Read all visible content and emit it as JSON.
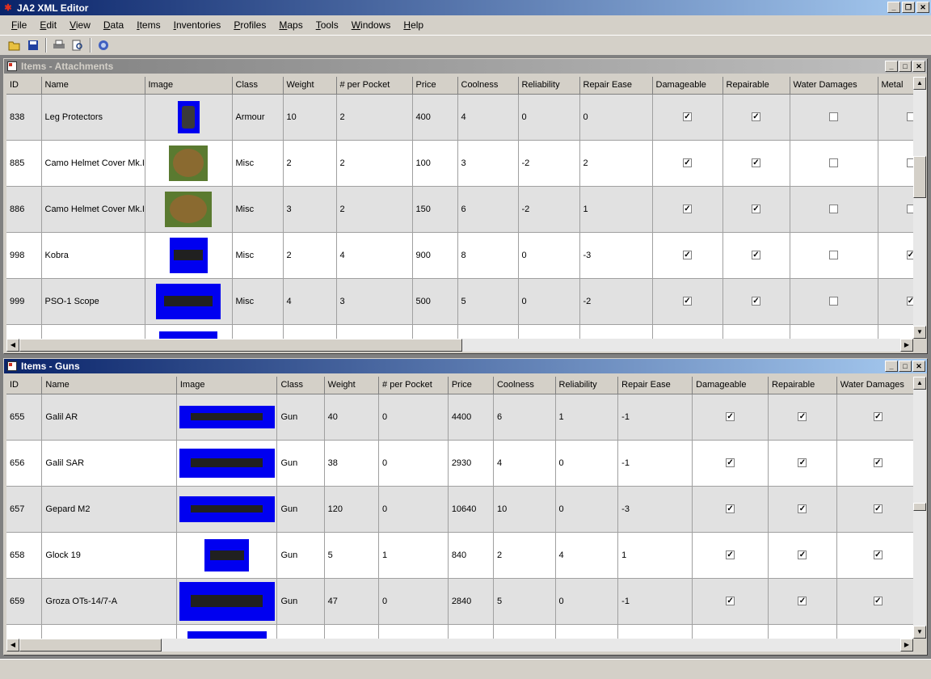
{
  "app": {
    "title": "JA2 XML Editor"
  },
  "menu": [
    {
      "u": "F",
      "rest": "ile"
    },
    {
      "u": "E",
      "rest": "dit"
    },
    {
      "u": "V",
      "rest": "iew"
    },
    {
      "u": "D",
      "rest": "ata"
    },
    {
      "u": "I",
      "rest": "tems"
    },
    {
      "u": "I",
      "rest": "nventories"
    },
    {
      "u": "P",
      "rest": "rofiles"
    },
    {
      "u": "M",
      "rest": "aps"
    },
    {
      "u": "T",
      "rest": "ools"
    },
    {
      "u": "W",
      "rest": "indows"
    },
    {
      "u": "H",
      "rest": "elp"
    }
  ],
  "toolbar": [
    "open-icon",
    "save-icon",
    "print-icon",
    "print-preview-icon",
    "help-icon"
  ],
  "attachments": {
    "title": "Items - Attachments",
    "columns": [
      "ID",
      "Name",
      "Image",
      "Class",
      "Weight",
      "# per Pocket",
      "Price",
      "Coolness",
      "Reliability",
      "Repair Ease",
      "Damageable",
      "Repairable",
      "Water Damages",
      "Metal"
    ],
    "rows": [
      {
        "id": "838",
        "name": "Leg Protectors",
        "img": "dark",
        "class": "Armour",
        "weight": "10",
        "pocket": "2",
        "price": "400",
        "cool": "4",
        "rel": "0",
        "rep": "0",
        "dmg": true,
        "repair": true,
        "water": false,
        "metal": false
      },
      {
        "id": "885",
        "name": "Camo Helmet Cover Mk.I",
        "img": "camo",
        "class": "Misc",
        "weight": "2",
        "pocket": "2",
        "price": "100",
        "cool": "3",
        "rel": "-2",
        "rep": "2",
        "dmg": true,
        "repair": true,
        "water": false,
        "metal": false
      },
      {
        "id": "886",
        "name": "Camo Helmet Cover Mk.II",
        "img": "camo",
        "class": "Misc",
        "weight": "3",
        "pocket": "2",
        "price": "150",
        "cool": "6",
        "rel": "-2",
        "rep": "1",
        "dmg": true,
        "repair": true,
        "water": false,
        "metal": false
      },
      {
        "id": "998",
        "name": "Kobra",
        "img": "blue",
        "class": "Misc",
        "weight": "2",
        "pocket": "4",
        "price": "900",
        "cool": "8",
        "rel": "0",
        "rep": "-3",
        "dmg": true,
        "repair": true,
        "water": false,
        "metal": true
      },
      {
        "id": "999",
        "name": "PSO-1 Scope",
        "img": "blue",
        "class": "Misc",
        "weight": "4",
        "pocket": "3",
        "price": "500",
        "cool": "5",
        "rel": "0",
        "rep": "-2",
        "dmg": true,
        "repair": true,
        "water": false,
        "metal": true
      }
    ]
  },
  "guns": {
    "title": "Items - Guns",
    "columns": [
      "ID",
      "Name",
      "Image",
      "Class",
      "Weight",
      "# per Pocket",
      "Price",
      "Coolness",
      "Reliability",
      "Repair Ease",
      "Damageable",
      "Repairable",
      "Water Damages"
    ],
    "rows": [
      {
        "id": "655",
        "name": "Galil AR",
        "img": "blue",
        "class": "Gun",
        "weight": "40",
        "pocket": "0",
        "price": "4400",
        "cool": "6",
        "rel": "1",
        "rep": "-1",
        "dmg": true,
        "repair": true,
        "water": true
      },
      {
        "id": "656",
        "name": "Galil SAR",
        "img": "blue",
        "class": "Gun",
        "weight": "38",
        "pocket": "0",
        "price": "2930",
        "cool": "4",
        "rel": "0",
        "rep": "-1",
        "dmg": true,
        "repair": true,
        "water": true
      },
      {
        "id": "657",
        "name": "Gepard M2",
        "img": "blue",
        "class": "Gun",
        "weight": "120",
        "pocket": "0",
        "price": "10640",
        "cool": "10",
        "rel": "0",
        "rep": "-3",
        "dmg": true,
        "repair": true,
        "water": true
      },
      {
        "id": "658",
        "name": "Glock 19",
        "img": "blue",
        "class": "Gun",
        "weight": "5",
        "pocket": "1",
        "price": "840",
        "cool": "2",
        "rel": "4",
        "rep": "1",
        "dmg": true,
        "repair": true,
        "water": true
      },
      {
        "id": "659",
        "name": "Groza OTs-14/7-A",
        "img": "blue",
        "class": "Gun",
        "weight": "47",
        "pocket": "0",
        "price": "2840",
        "cool": "5",
        "rel": "0",
        "rep": "-1",
        "dmg": true,
        "repair": true,
        "water": true
      }
    ]
  }
}
